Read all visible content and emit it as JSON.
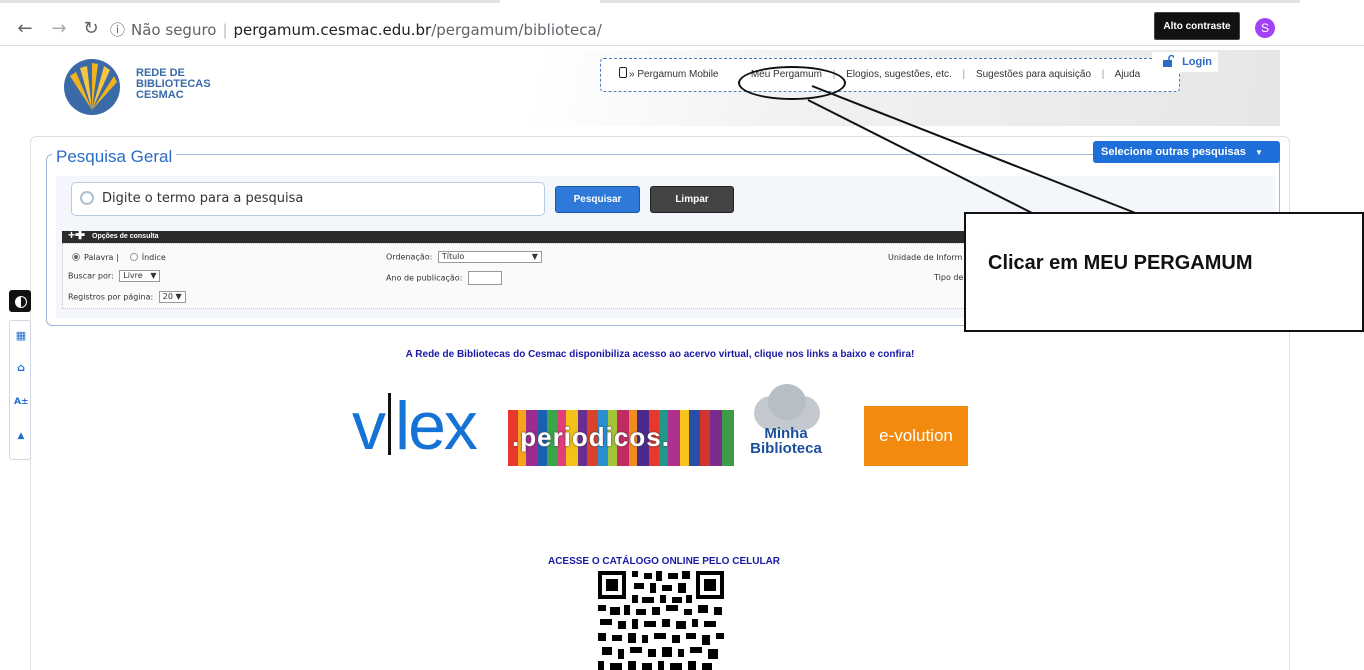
{
  "browser": {
    "security_label": "Não seguro",
    "url_host": "pergamum.cesmac.edu.br",
    "url_path": "/pergamum/biblioteca/",
    "avatar_letter": "S"
  },
  "header": {
    "logo_lines": [
      "REDE DE",
      "BIBLIOTECAS",
      "CESMAC"
    ],
    "nav": {
      "mobile": "» Pergamum Mobile",
      "meu": "Meu Pergamum",
      "elogios": "Elogios, sugestões, etc.",
      "sugestoes": "Sugestões para aquisição",
      "ajuda": "Ajuda"
    },
    "contrast_label": "Alto contraste",
    "login_label": "Login"
  },
  "search": {
    "title": "Pesquisa Geral",
    "other_label": "Selecione outras pesquisas",
    "placeholder": "Digite o termo para a pesquisa",
    "search_label": "Pesquisar",
    "clear_label": "Limpar",
    "options_title": "Opções de consulta",
    "palavra": "Palavra |",
    "indice": "Índice",
    "buscar_label": "Buscar por:",
    "buscar_value": "Livre",
    "registros_label": "Registros por página:",
    "registros_value": "20",
    "ordenacao_label": "Ordenação:",
    "ordenacao_value": "Título",
    "ano_label": "Ano de publicação:",
    "unidade_label": "Unidade de Inform",
    "tipo_label": "Tipo de"
  },
  "callout": {
    "text": "Clicar em MEU PERGAMUM"
  },
  "content": {
    "announce": "A Rede de Bibliotecas do Cesmac disponibiliza acesso ao acervo virtual, clique nos links a baixo e confira!",
    "vlex_v": "v",
    "vlex_rest": "lex",
    "periodicos": ".periodicos.",
    "minha_line1": "Minha",
    "minha_line2": "Biblioteca",
    "evolution": "e-volution",
    "acesse": "ACESSE O CATÁLOGO ONLINE PELO CELULAR"
  }
}
